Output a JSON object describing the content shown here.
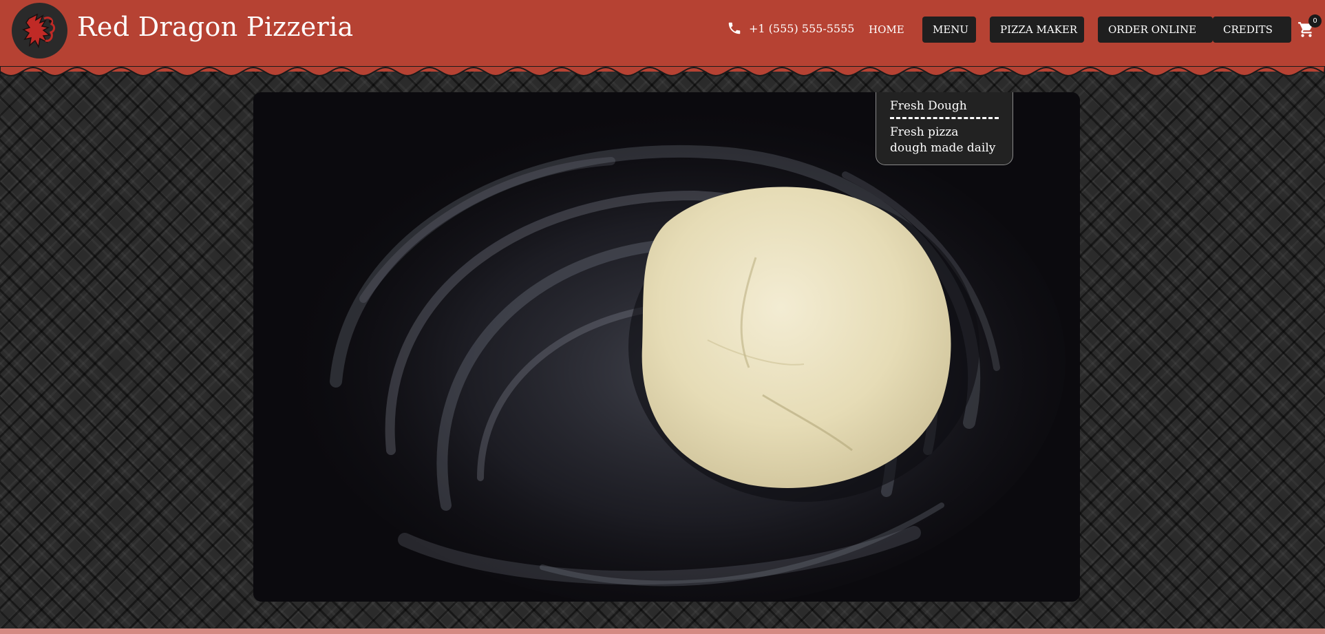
{
  "brand": {
    "name": "Red Dragon Pizzeria",
    "logo_icon": "dragon-icon"
  },
  "contact": {
    "phone": "+1 (555) 555-5555",
    "phone_icon": "phone-icon"
  },
  "nav": {
    "home": "HOME",
    "menu": "MENU",
    "pizza_maker": "PIZZA MAKER",
    "order_online": "ORDER ONLINE",
    "credits": "CREDITS"
  },
  "cart": {
    "icon": "cart-icon",
    "count": "0"
  },
  "hero": {
    "image": "pizza-dough-ball-on-floured-surface",
    "caption_title": "Fresh Dough",
    "caption_text": "Fresh pizza dough made daily"
  },
  "colors": {
    "header_red": "#b64233",
    "button_dark": "#1f1f1f",
    "background_dark": "#2b2b2b",
    "footer_pink": "#d48a83"
  }
}
